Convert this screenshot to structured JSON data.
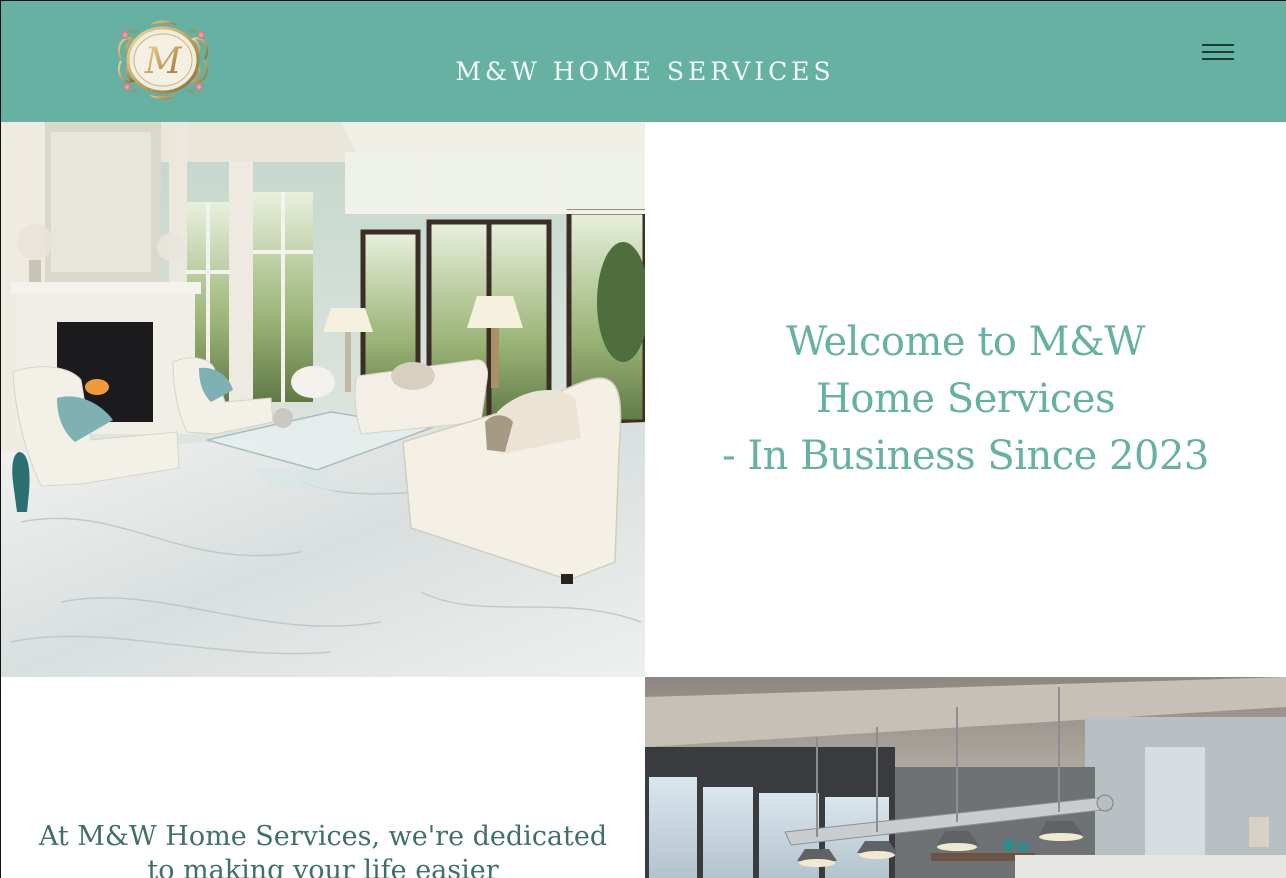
{
  "header": {
    "site_title": "M&W HOME SERVICES",
    "logo_monogram": "M",
    "menu_icon": "hamburger-menu-icon",
    "background_color": "#67b1a2"
  },
  "hero": {
    "image": "living-room-photo",
    "heading_lines": [
      "Welcome to M&W",
      "Home Services",
      "- In Business Since 2023"
    ],
    "heading_color": "#67b1a2"
  },
  "intro": {
    "text": "At M&W Home Services, we're dedicated to making your life easier",
    "text_color": "#3f6f66"
  },
  "kitchen": {
    "image": "kitchen-photo"
  }
}
